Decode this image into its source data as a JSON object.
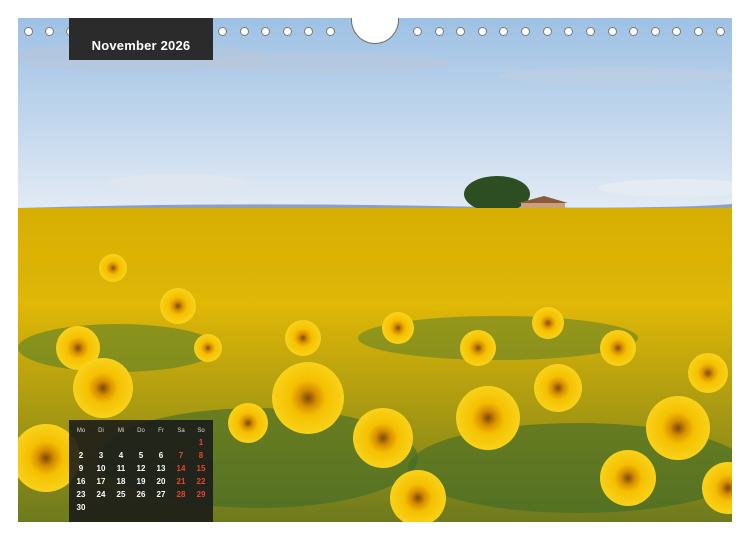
{
  "month_title": "November 2026",
  "calendar": {
    "weekday_headers": [
      "Mo",
      "Di",
      "Mi",
      "Do",
      "Fr",
      "Sa",
      "So"
    ],
    "rows": [
      [
        "",
        "",
        "",
        "",
        "",
        "",
        "1"
      ],
      [
        "2",
        "3",
        "4",
        "5",
        "6",
        "7",
        "8"
      ],
      [
        "9",
        "10",
        "11",
        "12",
        "13",
        "14",
        "15"
      ],
      [
        "16",
        "17",
        "18",
        "19",
        "20",
        "21",
        "22"
      ],
      [
        "23",
        "24",
        "25",
        "26",
        "27",
        "28",
        "29"
      ],
      [
        "30",
        "",
        "",
        "",
        "",
        "",
        ""
      ]
    ]
  },
  "colors": {
    "sky_top": "#a9c9e8",
    "sky_bottom": "#dfe8f3",
    "sunflower": "#f2c200",
    "foliage": "#3f6b2a",
    "weekend": "#e8442b"
  },
  "photo_subject": "sunflower field with a tree and small house on the horizon"
}
